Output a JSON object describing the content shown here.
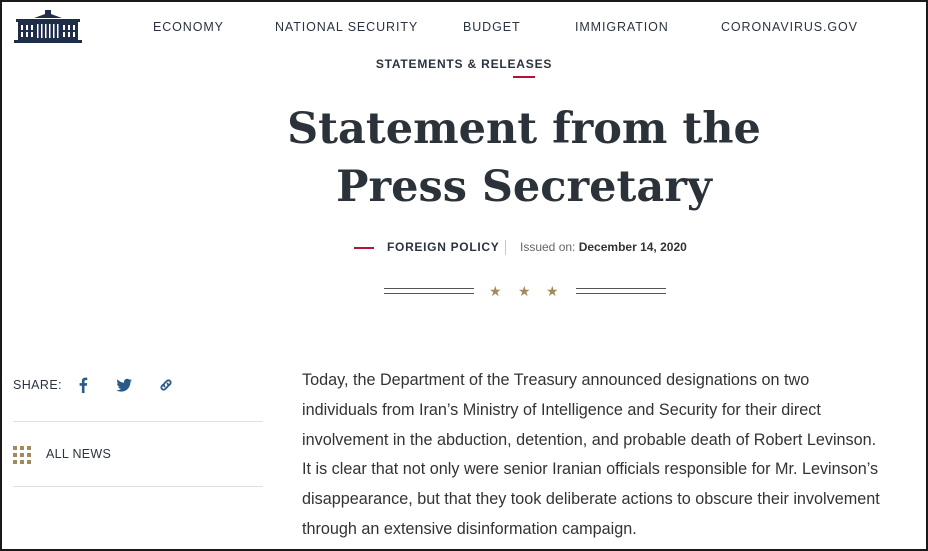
{
  "nav": {
    "items": [
      "ECONOMY",
      "NATIONAL SECURITY",
      "BUDGET",
      "IMMIGRATION",
      "CORONAVIRUS.GOV"
    ]
  },
  "subnav": {
    "active": "STATEMENTS & RELEASES"
  },
  "article": {
    "title": "Statement from the Press Secretary",
    "category": "FOREIGN POLICY",
    "issued_label": "Issued on:",
    "issued_date": "December 14, 2020",
    "body_lines": [
      "Today, the Department of the Treasury announced designations on two",
      "individuals from Iran’s Ministry of Intelligence and Security for their direct",
      "involvement in the abduction, detention, and probable death of Robert Levinson.",
      "It is clear that not only were senior Iranian officials responsible for Mr. Levinson’s",
      "disappearance, but that they took deliberate actions to obscure their involvement",
      "through an extensive disinformation campaign."
    ]
  },
  "sidebar": {
    "share_label": "SHARE:",
    "share_icons": [
      "facebook-icon",
      "twitter-icon",
      "link-icon"
    ],
    "all_news_label": "ALL NEWS"
  },
  "colors": {
    "accent_red": "#b3123a",
    "navy": "#2b3340",
    "star_gold": "#a48a5a",
    "social_blue": "#2a5a8a"
  }
}
